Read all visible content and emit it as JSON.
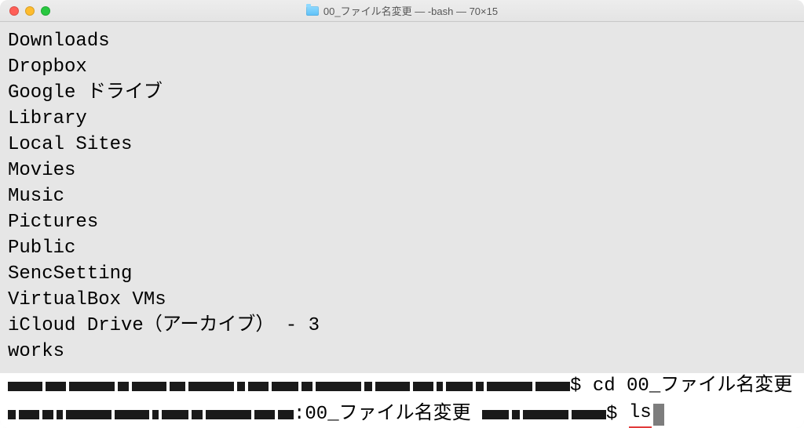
{
  "title": "00_ファイル名変更 — -bash — 70×15",
  "output_lines": [
    "Downloads",
    "Dropbox",
    "Google ドライブ",
    "Library",
    "Local Sites",
    "Movies",
    "Music",
    "Pictures",
    "Public",
    "SencSetting",
    "VirtualBox VMs",
    "iCloud Drive（アーカイブ） - 3",
    "works"
  ],
  "prompt1": {
    "dollar": "$ ",
    "command": "cd 00_ファイル名変更"
  },
  "prompt2": {
    "sep": ":",
    "cwd": "00_ファイル名変更",
    "dollar": "$ ",
    "command": "ls"
  }
}
